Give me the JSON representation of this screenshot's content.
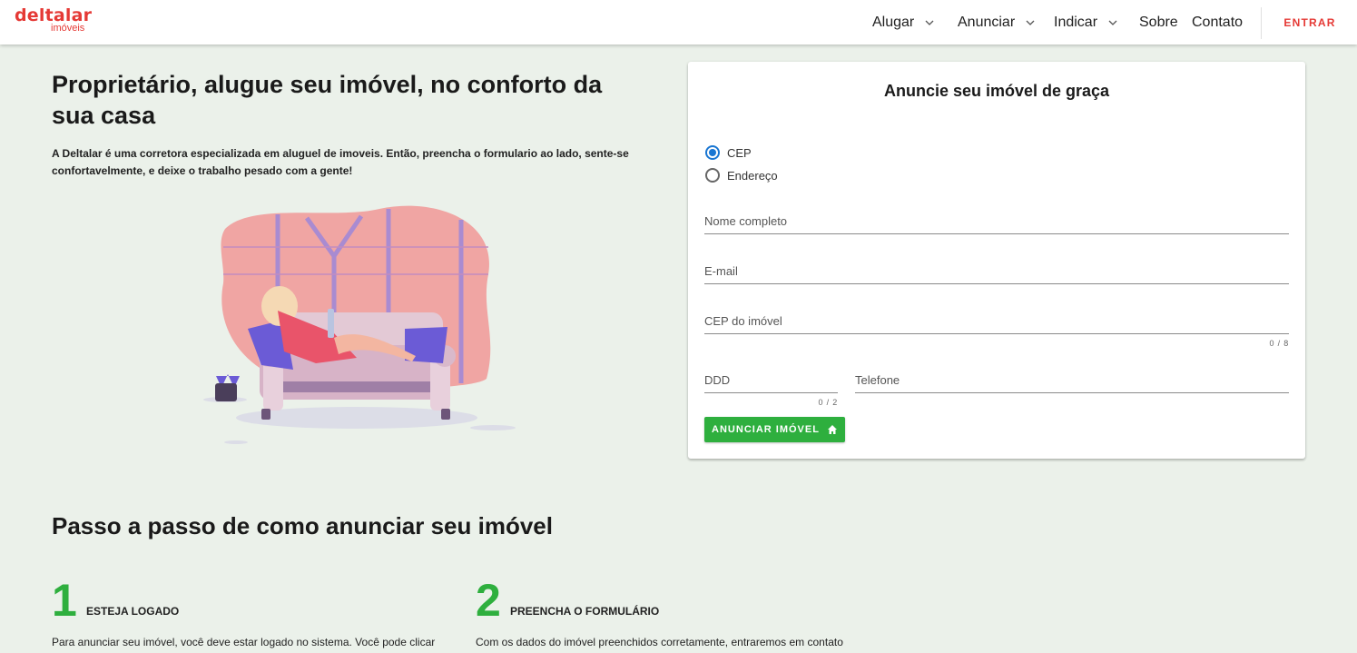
{
  "brand": {
    "logo_main": "deltalar",
    "logo_sub": "imóveis",
    "accent": "#e53935",
    "green": "#2eaf3e",
    "blue": "#1976d2"
  },
  "nav": {
    "items": [
      {
        "label": "Alugar",
        "has_dropdown": true
      },
      {
        "label": "Anunciar",
        "has_dropdown": true
      },
      {
        "label": "Indicar",
        "has_dropdown": true
      },
      {
        "label": "Sobre",
        "has_dropdown": false
      },
      {
        "label": "Contato",
        "has_dropdown": false
      }
    ],
    "login_label": "ENTRAR"
  },
  "hero": {
    "title": "Proprietário, alugue seu imóvel, no conforto da sua casa",
    "description": "A Deltalar é uma corretora especializada em aluguel de imoveis. Então, preencha o formulario ao lado, sente-se confortavelmente, e deixe o trabalho pesado com a gente!"
  },
  "form": {
    "title": "Anuncie seu imóvel de graça",
    "radios": [
      {
        "label": "CEP",
        "selected": true
      },
      {
        "label": "Endereço",
        "selected": false
      }
    ],
    "fields": {
      "name": {
        "placeholder": "Nome completo",
        "value": ""
      },
      "email": {
        "placeholder": "E-mail",
        "value": ""
      },
      "cep": {
        "placeholder": "CEP do imóvel",
        "value": "",
        "counter": "0 / 8"
      },
      "ddd": {
        "placeholder": "DDD",
        "value": "",
        "counter": "0 / 2"
      },
      "phone": {
        "placeholder": "Telefone",
        "value": ""
      }
    },
    "submit_label": "ANUNCIAR IMÓVEL",
    "submit_icon": "home-icon"
  },
  "steps": {
    "title": "Passo a passo de como anunciar seu imóvel",
    "items": [
      {
        "number": "1",
        "heading": "ESTEJA LOGADO",
        "text": "Para anunciar seu imóvel, você deve estar logado no sistema. Você pode clicar"
      },
      {
        "number": "2",
        "heading": "PREENCHA O FORMULÁRIO",
        "text": "Com os dados do imóvel preenchidos corretamente, entraremos em contato"
      }
    ]
  }
}
